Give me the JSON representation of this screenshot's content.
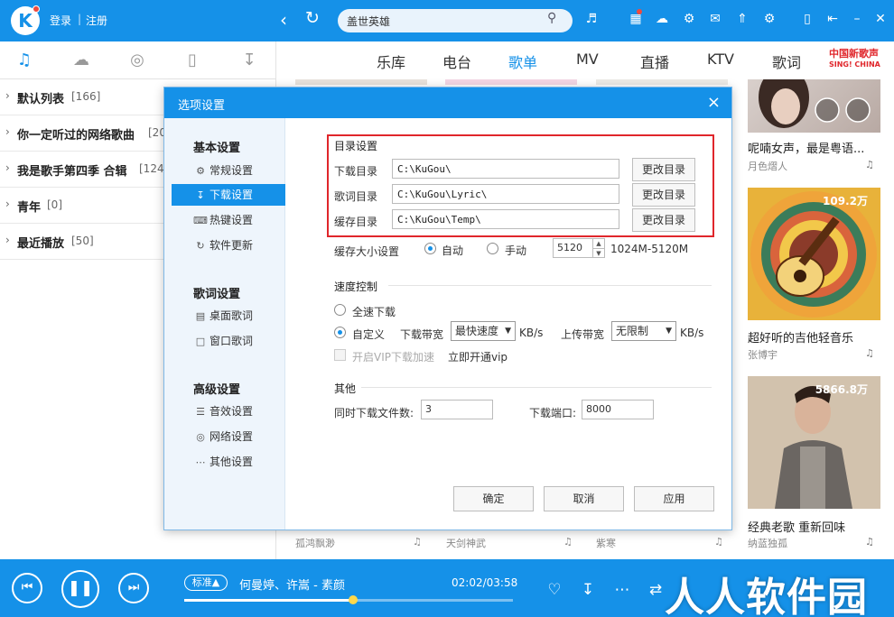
{
  "topbar": {
    "login": "登录",
    "separator": "|",
    "register": "注册",
    "search_value": "盖世英雄",
    "icons": [
      "mic-icon",
      "skin-icon",
      "cloud-icon",
      "game-icon",
      "mail-icon",
      "shirt-icon",
      "gear-icon",
      "mobile-icon",
      "minimize-mode-icon",
      "minimize-icon",
      "close-icon"
    ]
  },
  "left_tabs": [
    "music-note-icon",
    "cloud-icon",
    "radio-icon",
    "device-icon",
    "download-icon"
  ],
  "playlists": [
    {
      "name": "默认列表",
      "count": "[166]"
    },
    {
      "name": "你一定听过的网络歌曲",
      "count": "[20"
    },
    {
      "name": "我是歌手第四季 合辑",
      "count": "[124]"
    },
    {
      "name": "青年",
      "count": "[0]"
    },
    {
      "name": "最近播放",
      "count": "[50]"
    }
  ],
  "categories": [
    "乐库",
    "电台",
    "歌单",
    "MV",
    "直播",
    "KTV",
    "歌词"
  ],
  "active_category": "歌单",
  "brand_logo": {
    "line1": "中国新歌声",
    "line2": "SING! CHINA"
  },
  "cards": [
    {
      "title": "呢喃女声，最是粤语...",
      "author": "月色熠人",
      "count": ""
    },
    {
      "title": "超好听的吉他轻音乐",
      "author": "张博宇",
      "count": "109.2万"
    },
    {
      "title": "经典老歌 重新回味",
      "author": "纳蓝独孤",
      "count": "5866.8万"
    }
  ],
  "bottom_row": [
    "孤鸿飘渺",
    "天剑神武",
    "紫寒"
  ],
  "dialog": {
    "title": "选项设置",
    "close": "×",
    "side": {
      "groups": [
        {
          "label": "基本设置",
          "items": [
            {
              "label": "常规设置",
              "icon": "settings-icon"
            },
            {
              "label": "下载设置",
              "icon": "download-icon"
            },
            {
              "label": "热键设置",
              "icon": "keyboard-icon"
            },
            {
              "label": "软件更新",
              "icon": "update-icon"
            }
          ]
        },
        {
          "label": "歌词设置",
          "items": [
            {
              "label": "桌面歌词",
              "icon": "desktop-lyric-icon"
            },
            {
              "label": "窗口歌词",
              "icon": "window-lyric-icon"
            }
          ]
        },
        {
          "label": "高级设置",
          "items": [
            {
              "label": "音效设置",
              "icon": "equalizer-icon"
            },
            {
              "label": "网络设置",
              "icon": "network-icon"
            },
            {
              "label": "其他设置",
              "icon": "more-icon"
            }
          ]
        }
      ]
    },
    "dir": {
      "title": "目录设置",
      "rows": [
        {
          "label": "下载目录",
          "value": "C:\\KuGou\\",
          "button": "更改目录"
        },
        {
          "label": "歌词目录",
          "value": "C:\\KuGou\\Lyric\\",
          "button": "更改目录"
        },
        {
          "label": "缓存目录",
          "value": "C:\\KuGou\\Temp\\",
          "button": "更改目录"
        }
      ]
    },
    "cache": {
      "label": "缓存大小设置",
      "auto": "自动",
      "manual": "手动",
      "value": "5120",
      "range": "1024M-5120M"
    },
    "speed": {
      "title": "速度控制",
      "full": "全速下载",
      "custom": "自定义",
      "download_label": "下载带宽",
      "download_value": "最快速度",
      "unit1": "KB/s",
      "upload_label": "上传带宽",
      "upload_value": "无限制",
      "unit2": "KB/s",
      "vip_accel": "开启VIP下载加速",
      "vip_link": "立即开通vip"
    },
    "other": {
      "title": "其他",
      "concurrent_label": "同时下载文件数:",
      "concurrent_value": "3",
      "port_label": "下载端口:",
      "port_value": "8000"
    },
    "buttons": {
      "ok": "确定",
      "cancel": "取消",
      "apply": "应用"
    }
  },
  "player": {
    "quality": "标准▲",
    "song": "何曼婷、许嵩 - 素颜",
    "time": "02:02/03:58",
    "progress": 0.515,
    "watermark": "人人软件园"
  },
  "colors": {
    "accent": "#1591e8",
    "highlight": "#e0262b"
  }
}
